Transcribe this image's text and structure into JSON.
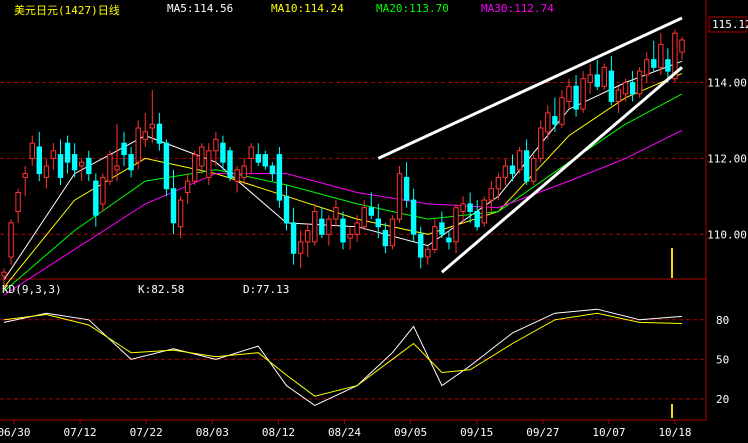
{
  "header": {
    "title": "美元日元(1427)日线",
    "ma5": "MA5:114.56",
    "ma10": "MA10:114.24",
    "ma20": "MA20:113.70",
    "ma30": "MA30:112.74",
    "last_price": "115.12"
  },
  "kd_header": {
    "name": "KD(9,3,3)",
    "k": "K:82.58",
    "d": "D:77.13"
  },
  "colors": {
    "up": "#ff3232",
    "down": "#00ffff",
    "ma5": "#ffffff",
    "ma10": "#ffff00",
    "ma20": "#00ff00",
    "ma30": "#ff00ff",
    "grid": "#b00000",
    "axis": "#b00000",
    "title": "#ffff00",
    "text": "#ffffff"
  },
  "chart_data": [
    {
      "type": "candlestick",
      "x_labels": [
        "06/30",
        "07/12",
        "07/22",
        "08/03",
        "08/12",
        "08/24",
        "09/05",
        "09/15",
        "09/27",
        "10/07",
        "10/18"
      ],
      "y_ticks": [
        110.0,
        112.0,
        114.0
      ],
      "ylim": [
        108.9,
        115.7
      ],
      "ohlc": [
        [
          108.9,
          109.1,
          108.6,
          109.0
        ],
        [
          109.4,
          110.4,
          109.2,
          110.3
        ],
        [
          110.6,
          111.2,
          110.3,
          111.1
        ],
        [
          111.5,
          111.8,
          111.0,
          111.6
        ],
        [
          112.0,
          112.6,
          111.8,
          112.4
        ],
        [
          112.3,
          112.7,
          111.4,
          111.6
        ],
        [
          111.5,
          112.0,
          111.2,
          111.8
        ],
        [
          112.0,
          112.4,
          111.7,
          112.2
        ],
        [
          112.1,
          112.5,
          111.3,
          111.5
        ],
        [
          112.4,
          112.6,
          111.6,
          111.9
        ],
        [
          112.1,
          112.4,
          111.5,
          111.7
        ],
        [
          111.8,
          112.0,
          111.4,
          111.9
        ],
        [
          112.0,
          112.2,
          111.4,
          111.6
        ],
        [
          111.4,
          111.6,
          110.2,
          110.5
        ],
        [
          110.8,
          111.6,
          110.6,
          111.5
        ],
        [
          111.4,
          112.2,
          111.3,
          112.1
        ],
        [
          111.7,
          112.9,
          111.4,
          111.8
        ],
        [
          112.4,
          112.7,
          111.8,
          112.1
        ],
        [
          112.1,
          112.3,
          111.5,
          111.7
        ],
        [
          111.9,
          113.0,
          111.7,
          112.8
        ],
        [
          112.5,
          113.2,
          112.3,
          112.7
        ],
        [
          112.8,
          113.8,
          112.4,
          112.9
        ],
        [
          112.9,
          113.2,
          112.2,
          112.4
        ],
        [
          112.4,
          112.5,
          111.0,
          111.2
        ],
        [
          111.2,
          111.7,
          110.0,
          110.3
        ],
        [
          110.2,
          111.0,
          109.9,
          110.9
        ],
        [
          111.1,
          111.6,
          110.8,
          111.4
        ],
        [
          111.4,
          112.2,
          111.3,
          112.1
        ],
        [
          111.8,
          112.4,
          111.6,
          112.3
        ],
        [
          111.5,
          112.4,
          111.3,
          112.2
        ],
        [
          112.2,
          112.7,
          111.8,
          112.5
        ],
        [
          112.4,
          112.6,
          111.7,
          111.9
        ],
        [
          112.2,
          112.3,
          111.4,
          111.5
        ],
        [
          111.4,
          111.8,
          111.1,
          111.7
        ],
        [
          111.5,
          112.0,
          111.3,
          111.8
        ],
        [
          112.0,
          112.4,
          111.6,
          112.3
        ],
        [
          112.1,
          112.4,
          111.8,
          111.9
        ],
        [
          112.1,
          112.2,
          111.7,
          111.8
        ],
        [
          111.8,
          111.9,
          111.4,
          111.6
        ],
        [
          112.1,
          112.3,
          110.7,
          110.9
        ],
        [
          111.0,
          111.3,
          110.1,
          110.3
        ],
        [
          110.3,
          110.7,
          109.2,
          109.5
        ],
        [
          109.5,
          110.1,
          109.1,
          109.8
        ],
        [
          109.8,
          110.3,
          109.4,
          110.1
        ],
        [
          109.8,
          110.8,
          109.7,
          110.6
        ],
        [
          110.4,
          110.7,
          109.9,
          110.0
        ],
        [
          110.0,
          110.5,
          109.7,
          110.4
        ],
        [
          110.4,
          110.9,
          110.2,
          110.7
        ],
        [
          110.4,
          110.6,
          109.6,
          109.8
        ],
        [
          109.9,
          110.2,
          109.6,
          110.0
        ],
        [
          110.0,
          110.5,
          109.8,
          110.3
        ],
        [
          110.2,
          110.9,
          110.1,
          110.7
        ],
        [
          110.7,
          111.1,
          110.4,
          110.5
        ],
        [
          110.4,
          110.8,
          109.9,
          110.2
        ],
        [
          110.1,
          110.3,
          109.5,
          109.7
        ],
        [
          109.7,
          110.5,
          109.6,
          110.4
        ],
        [
          110.4,
          111.8,
          110.3,
          111.6
        ],
        [
          111.5,
          111.9,
          110.7,
          110.9
        ],
        [
          110.9,
          111.2,
          109.8,
          110.0
        ],
        [
          110.0,
          110.2,
          109.1,
          109.4
        ],
        [
          109.4,
          109.7,
          109.2,
          109.6
        ],
        [
          109.6,
          110.4,
          109.5,
          110.2
        ],
        [
          110.3,
          110.6,
          109.9,
          110.0
        ],
        [
          109.9,
          110.1,
          109.6,
          109.8
        ],
        [
          109.8,
          110.8,
          109.5,
          110.7
        ],
        [
          110.6,
          111.0,
          110.3,
          110.8
        ],
        [
          110.8,
          111.1,
          110.3,
          110.6
        ],
        [
          110.6,
          110.9,
          110.1,
          110.2
        ],
        [
          110.3,
          111.0,
          110.2,
          110.9
        ],
        [
          110.9,
          111.4,
          110.6,
          111.2
        ],
        [
          111.2,
          111.6,
          110.9,
          111.5
        ],
        [
          111.5,
          112.0,
          111.3,
          111.8
        ],
        [
          111.8,
          112.1,
          111.4,
          111.6
        ],
        [
          111.7,
          112.3,
          111.6,
          112.2
        ],
        [
          112.2,
          112.5,
          111.3,
          111.4
        ],
        [
          111.4,
          112.1,
          111.3,
          112.0
        ],
        [
          112.0,
          113.0,
          111.9,
          112.8
        ],
        [
          112.7,
          113.4,
          112.5,
          113.2
        ],
        [
          113.1,
          113.6,
          112.7,
          112.9
        ],
        [
          112.9,
          113.8,
          112.8,
          113.6
        ],
        [
          113.5,
          114.1,
          113.3,
          113.9
        ],
        [
          113.9,
          114.2,
          113.1,
          113.3
        ],
        [
          113.3,
          114.3,
          113.2,
          114.1
        ],
        [
          114.0,
          114.5,
          113.7,
          114.2
        ],
        [
          114.2,
          114.6,
          113.8,
          113.9
        ],
        [
          113.9,
          114.5,
          113.8,
          114.4
        ],
        [
          114.3,
          114.7,
          113.4,
          113.5
        ],
        [
          113.5,
          113.9,
          113.2,
          113.8
        ],
        [
          113.7,
          114.1,
          113.5,
          114.0
        ],
        [
          114.0,
          114.3,
          113.5,
          113.7
        ],
        [
          113.7,
          114.4,
          113.6,
          114.3
        ],
        [
          114.2,
          114.8,
          114.0,
          114.6
        ],
        [
          114.6,
          115.1,
          114.3,
          114.4
        ],
        [
          114.4,
          115.3,
          114.2,
          115.0
        ],
        [
          114.6,
          114.9,
          114.0,
          114.3
        ],
        [
          114.1,
          115.4,
          114.0,
          115.3
        ],
        [
          114.8,
          115.2,
          114.6,
          115.12
        ]
      ],
      "ma_lines": {
        "MA5": [
          [
            0,
            108.8
          ],
          [
            10,
            111.6
          ],
          [
            20,
            112.6
          ],
          [
            30,
            111.9
          ],
          [
            40,
            110.3
          ],
          [
            50,
            110.2
          ],
          [
            60,
            109.7
          ],
          [
            70,
            111.0
          ],
          [
            80,
            113.3
          ],
          [
            88,
            114.0
          ],
          [
            96,
            114.56
          ]
        ],
        "MA10": [
          [
            0,
            108.6
          ],
          [
            10,
            110.9
          ],
          [
            20,
            112.0
          ],
          [
            30,
            111.6
          ],
          [
            40,
            111.0
          ],
          [
            50,
            110.4
          ],
          [
            60,
            110.0
          ],
          [
            70,
            110.6
          ],
          [
            80,
            112.6
          ],
          [
            88,
            113.6
          ],
          [
            96,
            114.24
          ]
        ],
        "MA20": [
          [
            0,
            108.5
          ],
          [
            10,
            110.1
          ],
          [
            20,
            111.4
          ],
          [
            30,
            111.7
          ],
          [
            40,
            111.3
          ],
          [
            50,
            110.8
          ],
          [
            60,
            110.4
          ],
          [
            70,
            110.6
          ],
          [
            80,
            111.9
          ],
          [
            88,
            112.9
          ],
          [
            96,
            113.7
          ]
        ],
        "MA30": [
          [
            0,
            108.4
          ],
          [
            10,
            109.6
          ],
          [
            20,
            110.8
          ],
          [
            30,
            111.6
          ],
          [
            40,
            111.6
          ],
          [
            50,
            111.1
          ],
          [
            60,
            110.8
          ],
          [
            70,
            110.7
          ],
          [
            80,
            111.4
          ],
          [
            88,
            112.0
          ],
          [
            96,
            112.74
          ]
        ]
      },
      "trend_lines": [
        {
          "from": [
            53,
            112.0
          ],
          "to": [
            96,
            115.7
          ]
        },
        {
          "from": [
            62,
            109.0
          ],
          "to": [
            96,
            114.4
          ]
        }
      ]
    },
    {
      "type": "line",
      "name": "KD(9,3,3)",
      "y_ticks": [
        20,
        50,
        80
      ],
      "ylim": [
        10,
        95
      ],
      "K": [
        [
          0,
          78
        ],
        [
          6,
          85
        ],
        [
          12,
          80
        ],
        [
          18,
          50
        ],
        [
          24,
          58
        ],
        [
          30,
          50
        ],
        [
          36,
          60
        ],
        [
          40,
          30
        ],
        [
          44,
          15
        ],
        [
          50,
          30
        ],
        [
          55,
          55
        ],
        [
          58,
          75
        ],
        [
          62,
          30
        ],
        [
          66,
          45
        ],
        [
          72,
          70
        ],
        [
          78,
          85
        ],
        [
          84,
          88
        ],
        [
          90,
          80
        ],
        [
          96,
          82.58
        ]
      ],
      "D": [
        [
          0,
          80
        ],
        [
          6,
          84
        ],
        [
          12,
          76
        ],
        [
          18,
          55
        ],
        [
          24,
          57
        ],
        [
          30,
          52
        ],
        [
          36,
          55
        ],
        [
          40,
          38
        ],
        [
          44,
          22
        ],
        [
          50,
          30
        ],
        [
          55,
          50
        ],
        [
          58,
          62
        ],
        [
          62,
          40
        ],
        [
          66,
          42
        ],
        [
          72,
          62
        ],
        [
          78,
          80
        ],
        [
          84,
          85
        ],
        [
          90,
          78
        ],
        [
          96,
          77.13
        ]
      ]
    }
  ]
}
